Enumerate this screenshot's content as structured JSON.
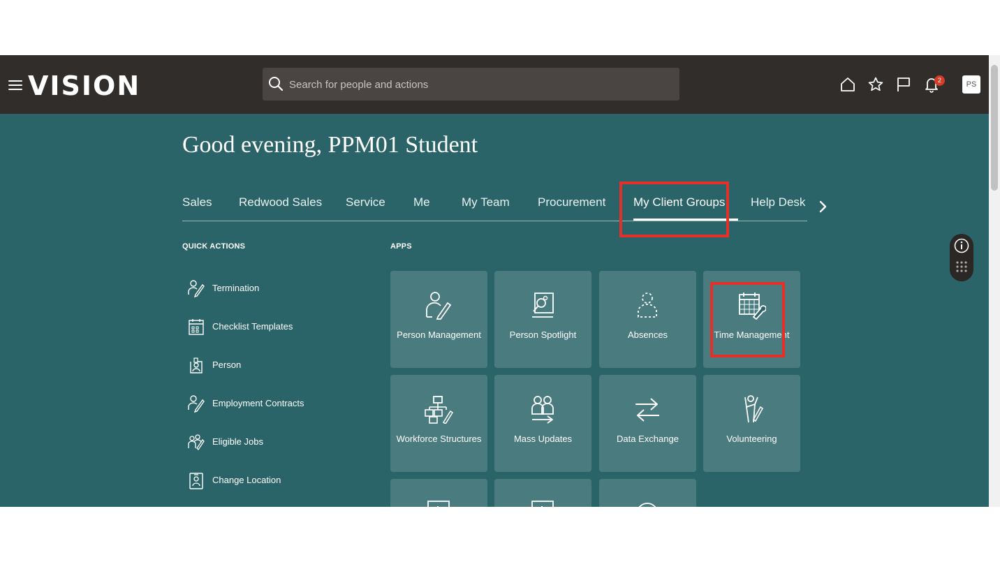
{
  "header": {
    "logo": "VISION",
    "search_placeholder": "Search for people and actions",
    "notification_count": "2",
    "avatar_initials": "PS"
  },
  "greeting": "Good evening, PPM01 Student",
  "tabs": [
    "Sales",
    "Redwood Sales",
    "Service",
    "Me",
    "My Team",
    "Procurement",
    "My Client Groups",
    "Help Desk"
  ],
  "active_tab": "My Client Groups",
  "quick_actions": {
    "heading": "QUICK ACTIONS",
    "items": [
      {
        "label": "Termination",
        "icon": "person-edit-icon"
      },
      {
        "label": "Checklist Templates",
        "icon": "checklist-icon"
      },
      {
        "label": "Person",
        "icon": "person-badge-icon"
      },
      {
        "label": "Employment Contracts",
        "icon": "contract-icon"
      },
      {
        "label": "Eligible Jobs",
        "icon": "jobs-icon"
      },
      {
        "label": "Change Location",
        "icon": "location-badge-icon"
      }
    ]
  },
  "apps": {
    "heading": "APPS",
    "tiles": [
      {
        "label": "Person Management",
        "icon": "person-pencil-icon"
      },
      {
        "label": "Person Spotlight",
        "icon": "spotlight-icon"
      },
      {
        "label": "Absences",
        "icon": "absence-person-icon"
      },
      {
        "label": "Time Management",
        "icon": "calendar-wrench-icon"
      },
      {
        "label": "Workforce Structures",
        "icon": "org-chart-icon"
      },
      {
        "label": "Mass Updates",
        "icon": "group-arrow-icon"
      },
      {
        "label": "Data Exchange",
        "icon": "exchange-arrows-icon"
      },
      {
        "label": "Volunteering",
        "icon": "volunteer-icon"
      }
    ]
  },
  "colors": {
    "header_bg": "#312d2a",
    "banner_bg": "#2b6468",
    "highlight": "#e3312a",
    "badge": "#d63b25"
  }
}
